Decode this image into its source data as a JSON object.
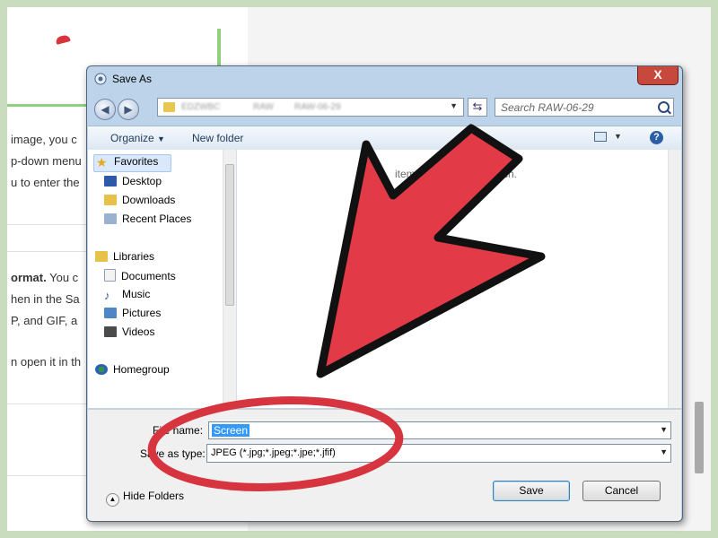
{
  "background": {
    "lines": [
      " image, you c",
      "p-down menu",
      "u to enter the",
      "ormat.",
      " You c",
      "hen in the Sa",
      "P, and GIF, a",
      "n open it in th"
    ]
  },
  "dialog": {
    "title": "Save As",
    "close_label": "X",
    "address": {
      "crumbs": [
        "EDZWBC",
        "RAW",
        "RAW-06-29"
      ]
    },
    "search": {
      "placeholder": "Search RAW-06-29"
    },
    "toolbar": {
      "organize": "Organize",
      "new_folder": "New folder",
      "help": "?"
    },
    "nav": {
      "favorites": "Favorites",
      "desktop": "Desktop",
      "downloads": "Downloads",
      "recent_places": "Recent Places",
      "libraries": "Libraries",
      "documents": "Documents",
      "music": "Music",
      "pictures": "Pictures",
      "videos": "Videos",
      "homegroup": "Homegroup"
    },
    "content": {
      "empty_message": "items m",
      "empty_message_tail": "rch."
    },
    "form": {
      "file_name_label": "File name:",
      "file_name_value": "Screen",
      "save_type_label": "Save as type:",
      "save_type_value": "JPEG (*.jpg;*.jpeg;*.jpe;*.jfif)",
      "hide_folders": "Hide Folders",
      "save": "Save",
      "cancel": "Cancel"
    }
  },
  "annotations": {
    "arrow_color": "#e23a47",
    "ellipse_color": "#d6343f",
    "outline_color": "#111111"
  },
  "colors": {
    "frame_green": "#c9dcbd",
    "selection_blue": "#3399ff"
  }
}
